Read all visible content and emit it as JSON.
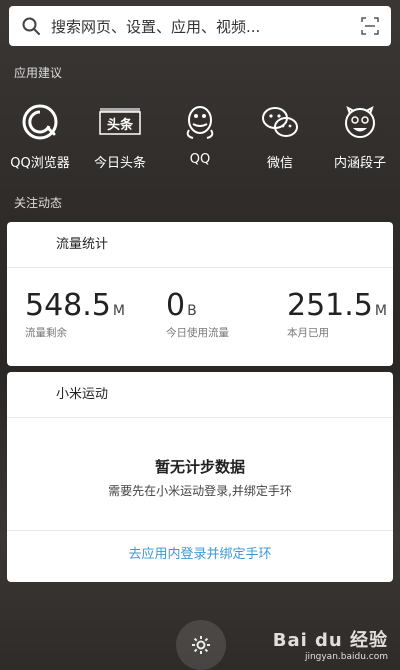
{
  "search": {
    "placeholder": "搜索网页、设置、应用、视频..."
  },
  "app_suggestions": {
    "label": "应用建议",
    "apps": [
      {
        "label": "QQ浏览器",
        "icon": "qq-browser-icon"
      },
      {
        "label": "今日头条",
        "icon": "toutiao-icon"
      },
      {
        "label": "QQ",
        "icon": "qq-penguin-icon"
      },
      {
        "label": "微信",
        "icon": "wechat-icon"
      },
      {
        "label": "内涵段子",
        "icon": "neihan-icon"
      }
    ],
    "toutiao_logo_text": "头条"
  },
  "following": {
    "label": "关注动态"
  },
  "traffic_card": {
    "title": "流量统计",
    "stats": [
      {
        "value": "548.5",
        "unit": "M",
        "label": "流量剩余"
      },
      {
        "value": "0",
        "unit": "B",
        "label": "今日使用流量"
      },
      {
        "value": "251.5",
        "unit": "M",
        "label": "本月已用"
      }
    ]
  },
  "mi_sport_card": {
    "title": "小米运动",
    "empty_title": "暂无计步数据",
    "empty_sub": "需要先在小米运动登录,并绑定手环",
    "link": "去应用内登录并绑定手环"
  },
  "watermark": {
    "brand": "Bai du 经验",
    "url": "jingyan.baidu.com"
  },
  "colors": {
    "link": "#3a9ad9",
    "card_bg": "#ffffff"
  }
}
